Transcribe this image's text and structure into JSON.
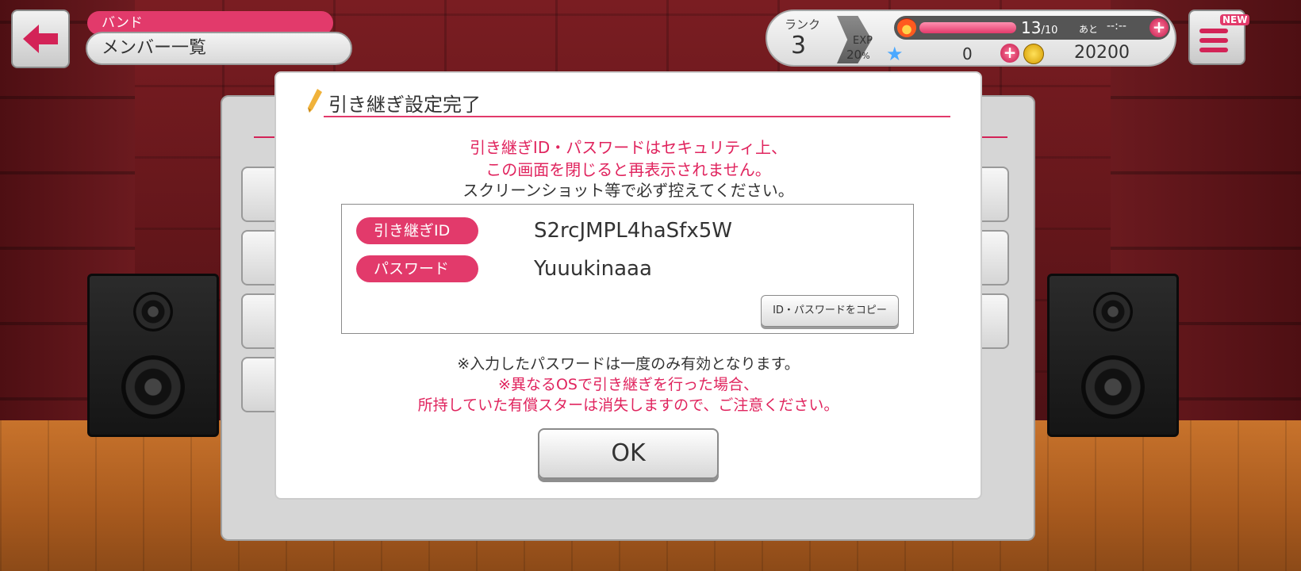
{
  "header": {
    "breadcrumb": "バンド",
    "page_title": "メンバー一覧"
  },
  "status": {
    "rank_label": "ランク",
    "rank_value": "3",
    "exp_label": "EXP",
    "exp_value": "20",
    "exp_unit": "%",
    "stamina_current": "13",
    "stamina_max": "/10",
    "stamina_fraction": 1.0,
    "remaining_label": "あと",
    "timer": "--:--",
    "star_count": "0",
    "coin_count": "20200",
    "menu_badge": "NEW"
  },
  "modal": {
    "title": "引き継ぎ設定完了",
    "warning_line1": "引き継ぎID・パスワードはセキュリティ上、",
    "warning_line2": "この画面を閉じると再表示されません。",
    "info_line": "スクリーンショット等で必ず控えてください。",
    "id_label": "引き継ぎID",
    "id_value": "S2rcJMPL4haSfx5W",
    "password_label": "パスワード",
    "password_value": "Yuuukinaaa",
    "copy_button": "ID・パスワードをコピー",
    "note_line": "※入力したパスワードは一度のみ有効となります。",
    "caution_line1": "※異なるOSで引き継ぎを行った場合、",
    "caution_line2": "所持していた有償スターは消失しますので、ご注意ください。",
    "ok_button": "OK"
  },
  "colors": {
    "accent": "#e23a6b",
    "warning_text": "#e0245e"
  }
}
